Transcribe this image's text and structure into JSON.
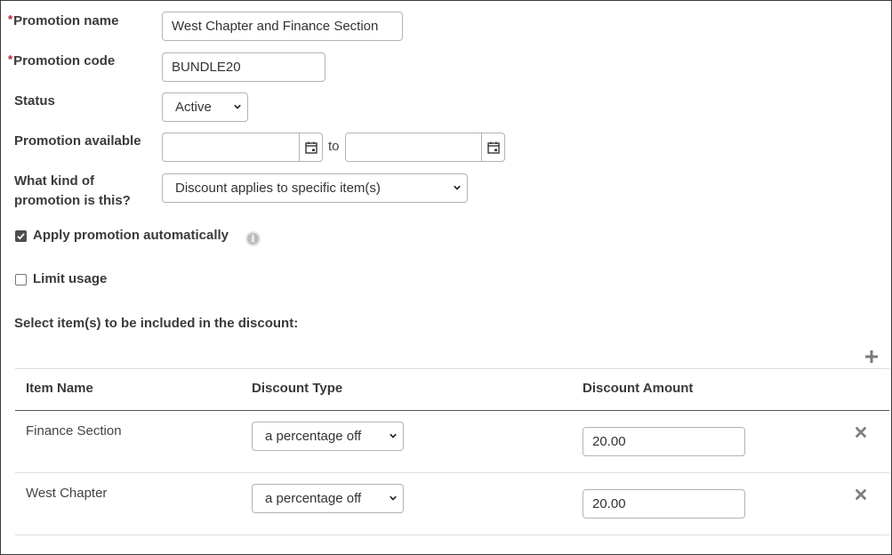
{
  "form": {
    "promotion_name": {
      "label": "Promotion name",
      "required_mark": "*",
      "value": "West Chapter and Finance Section"
    },
    "promotion_code": {
      "label": "Promotion code",
      "required_mark": "*",
      "value": "BUNDLE20"
    },
    "status": {
      "label": "Status",
      "value": "Active"
    },
    "promotion_available": {
      "label": "Promotion available",
      "from": "",
      "to_label": "to",
      "to": ""
    },
    "kind": {
      "label_line1": "What kind of",
      "label_line2": "promotion is this?",
      "value": "Discount applies to specific item(s)"
    },
    "apply_auto": {
      "label": "Apply promotion automatically",
      "checked": true,
      "info_icon": "info-icon"
    },
    "limit_usage": {
      "label": "Limit usage",
      "checked": false
    },
    "items_heading": "Select item(s) to be included in the discount:"
  },
  "table": {
    "add_icon": "plus-icon",
    "columns": [
      "Item Name",
      "Discount Type",
      "Discount Amount"
    ],
    "rows": [
      {
        "item_name": "Finance Section",
        "discount_type": "a percentage off",
        "discount_amount": "20.00"
      },
      {
        "item_name": "West Chapter",
        "discount_type": "a percentage off",
        "discount_amount": "20.00"
      }
    ],
    "remove_icon": "close-icon"
  },
  "colors": {
    "required": "#c8102e",
    "border": "#b3b3b3",
    "text": "#3a3a3a"
  }
}
